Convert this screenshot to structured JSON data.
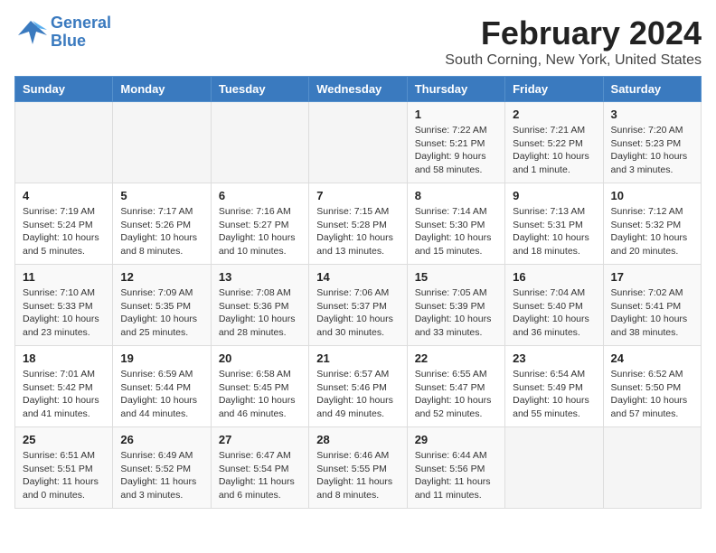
{
  "header": {
    "logo_line1": "General",
    "logo_line2": "Blue",
    "month_title": "February 2024",
    "location": "South Corning, New York, United States"
  },
  "days_of_week": [
    "Sunday",
    "Monday",
    "Tuesday",
    "Wednesday",
    "Thursday",
    "Friday",
    "Saturday"
  ],
  "weeks": [
    [
      {
        "day": "",
        "info": ""
      },
      {
        "day": "",
        "info": ""
      },
      {
        "day": "",
        "info": ""
      },
      {
        "day": "",
        "info": ""
      },
      {
        "day": "1",
        "info": "Sunrise: 7:22 AM\nSunset: 5:21 PM\nDaylight: 9 hours\nand 58 minutes."
      },
      {
        "day": "2",
        "info": "Sunrise: 7:21 AM\nSunset: 5:22 PM\nDaylight: 10 hours\nand 1 minute."
      },
      {
        "day": "3",
        "info": "Sunrise: 7:20 AM\nSunset: 5:23 PM\nDaylight: 10 hours\nand 3 minutes."
      }
    ],
    [
      {
        "day": "4",
        "info": "Sunrise: 7:19 AM\nSunset: 5:24 PM\nDaylight: 10 hours\nand 5 minutes."
      },
      {
        "day": "5",
        "info": "Sunrise: 7:17 AM\nSunset: 5:26 PM\nDaylight: 10 hours\nand 8 minutes."
      },
      {
        "day": "6",
        "info": "Sunrise: 7:16 AM\nSunset: 5:27 PM\nDaylight: 10 hours\nand 10 minutes."
      },
      {
        "day": "7",
        "info": "Sunrise: 7:15 AM\nSunset: 5:28 PM\nDaylight: 10 hours\nand 13 minutes."
      },
      {
        "day": "8",
        "info": "Sunrise: 7:14 AM\nSunset: 5:30 PM\nDaylight: 10 hours\nand 15 minutes."
      },
      {
        "day": "9",
        "info": "Sunrise: 7:13 AM\nSunset: 5:31 PM\nDaylight: 10 hours\nand 18 minutes."
      },
      {
        "day": "10",
        "info": "Sunrise: 7:12 AM\nSunset: 5:32 PM\nDaylight: 10 hours\nand 20 minutes."
      }
    ],
    [
      {
        "day": "11",
        "info": "Sunrise: 7:10 AM\nSunset: 5:33 PM\nDaylight: 10 hours\nand 23 minutes."
      },
      {
        "day": "12",
        "info": "Sunrise: 7:09 AM\nSunset: 5:35 PM\nDaylight: 10 hours\nand 25 minutes."
      },
      {
        "day": "13",
        "info": "Sunrise: 7:08 AM\nSunset: 5:36 PM\nDaylight: 10 hours\nand 28 minutes."
      },
      {
        "day": "14",
        "info": "Sunrise: 7:06 AM\nSunset: 5:37 PM\nDaylight: 10 hours\nand 30 minutes."
      },
      {
        "day": "15",
        "info": "Sunrise: 7:05 AM\nSunset: 5:39 PM\nDaylight: 10 hours\nand 33 minutes."
      },
      {
        "day": "16",
        "info": "Sunrise: 7:04 AM\nSunset: 5:40 PM\nDaylight: 10 hours\nand 36 minutes."
      },
      {
        "day": "17",
        "info": "Sunrise: 7:02 AM\nSunset: 5:41 PM\nDaylight: 10 hours\nand 38 minutes."
      }
    ],
    [
      {
        "day": "18",
        "info": "Sunrise: 7:01 AM\nSunset: 5:42 PM\nDaylight: 10 hours\nand 41 minutes."
      },
      {
        "day": "19",
        "info": "Sunrise: 6:59 AM\nSunset: 5:44 PM\nDaylight: 10 hours\nand 44 minutes."
      },
      {
        "day": "20",
        "info": "Sunrise: 6:58 AM\nSunset: 5:45 PM\nDaylight: 10 hours\nand 46 minutes."
      },
      {
        "day": "21",
        "info": "Sunrise: 6:57 AM\nSunset: 5:46 PM\nDaylight: 10 hours\nand 49 minutes."
      },
      {
        "day": "22",
        "info": "Sunrise: 6:55 AM\nSunset: 5:47 PM\nDaylight: 10 hours\nand 52 minutes."
      },
      {
        "day": "23",
        "info": "Sunrise: 6:54 AM\nSunset: 5:49 PM\nDaylight: 10 hours\nand 55 minutes."
      },
      {
        "day": "24",
        "info": "Sunrise: 6:52 AM\nSunset: 5:50 PM\nDaylight: 10 hours\nand 57 minutes."
      }
    ],
    [
      {
        "day": "25",
        "info": "Sunrise: 6:51 AM\nSunset: 5:51 PM\nDaylight: 11 hours\nand 0 minutes."
      },
      {
        "day": "26",
        "info": "Sunrise: 6:49 AM\nSunset: 5:52 PM\nDaylight: 11 hours\nand 3 minutes."
      },
      {
        "day": "27",
        "info": "Sunrise: 6:47 AM\nSunset: 5:54 PM\nDaylight: 11 hours\nand 6 minutes."
      },
      {
        "day": "28",
        "info": "Sunrise: 6:46 AM\nSunset: 5:55 PM\nDaylight: 11 hours\nand 8 minutes."
      },
      {
        "day": "29",
        "info": "Sunrise: 6:44 AM\nSunset: 5:56 PM\nDaylight: 11 hours\nand 11 minutes."
      },
      {
        "day": "",
        "info": ""
      },
      {
        "day": "",
        "info": ""
      }
    ]
  ]
}
